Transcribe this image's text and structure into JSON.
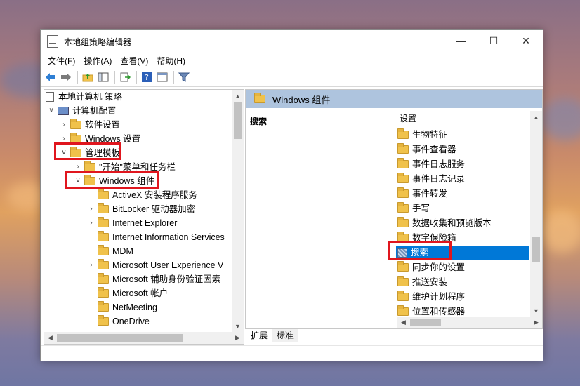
{
  "window": {
    "title": "本地组策略编辑器",
    "controls": {
      "minimize": "—",
      "maximize": "☐",
      "close": "✕"
    }
  },
  "menu": [
    "文件(F)",
    "操作(A)",
    "查看(V)",
    "帮助(H)"
  ],
  "toolbar": {
    "icons": [
      "back-arrow-icon",
      "forward-arrow-icon",
      "folder-up-icon",
      "show-hide-tree-icon",
      "export-list-icon",
      "help-icon",
      "properties-icon",
      "filter-icon"
    ]
  },
  "tree": {
    "items": [
      {
        "label": "本地计算机 策略",
        "icon": "doc",
        "chevron": ""
      },
      {
        "label": "计算机配置",
        "icon": "pc",
        "chevron": "v"
      },
      {
        "label": "软件设置",
        "icon": "folder",
        "chevron": ">"
      },
      {
        "label": "Windows 设置",
        "icon": "folder",
        "chevron": ">"
      },
      {
        "label": "管理模板",
        "icon": "folder",
        "chevron": "v"
      },
      {
        "label": "\"开始\"菜单和任务栏",
        "icon": "folder",
        "chevron": ">"
      },
      {
        "label": "Windows 组件",
        "icon": "folder",
        "chevron": "v"
      },
      {
        "label": "ActiveX 安装程序服务",
        "icon": "folder",
        "chevron": ""
      },
      {
        "label": "BitLocker 驱动器加密",
        "icon": "folder",
        "chevron": ">"
      },
      {
        "label": "Internet Explorer",
        "icon": "folder",
        "chevron": ">"
      },
      {
        "label": "Internet Information Services",
        "icon": "folder",
        "chevron": ""
      },
      {
        "label": "MDM",
        "icon": "folder",
        "chevron": ""
      },
      {
        "label": "Microsoft User Experience V",
        "icon": "folder",
        "chevron": ">"
      },
      {
        "label": "Microsoft 辅助身份验证因素",
        "icon": "folder",
        "chevron": ""
      },
      {
        "label": "Microsoft 帐户",
        "icon": "folder",
        "chevron": ""
      },
      {
        "label": "NetMeeting",
        "icon": "folder",
        "chevron": ""
      },
      {
        "label": "OneDrive",
        "icon": "folder",
        "chevron": ""
      }
    ]
  },
  "right": {
    "header": "Windows 组件",
    "selected_name": "搜索",
    "column_header": "设置",
    "list": [
      {
        "label": "生物特征",
        "icon": "folder"
      },
      {
        "label": "事件查看器",
        "icon": "folder"
      },
      {
        "label": "事件日志服务",
        "icon": "folder"
      },
      {
        "label": "事件日志记录",
        "icon": "folder"
      },
      {
        "label": "事件转发",
        "icon": "folder"
      },
      {
        "label": "手写",
        "icon": "folder"
      },
      {
        "label": "数据收集和预览版本",
        "icon": "folder"
      },
      {
        "label": "数字保险箱",
        "icon": "folder"
      },
      {
        "label": "搜索",
        "icon": "setting",
        "selected": true
      },
      {
        "label": "同步你的设置",
        "icon": "folder"
      },
      {
        "label": "推送安装",
        "icon": "folder"
      },
      {
        "label": "维护计划程序",
        "icon": "folder"
      },
      {
        "label": "位置和传感器",
        "icon": "folder"
      }
    ]
  },
  "tabs": [
    "扩展",
    "标准"
  ],
  "colors": {
    "accent": "#0078d7",
    "header_band": "#aec4de",
    "highlight_box": "#e0161e",
    "folder": "#f0c24b"
  }
}
